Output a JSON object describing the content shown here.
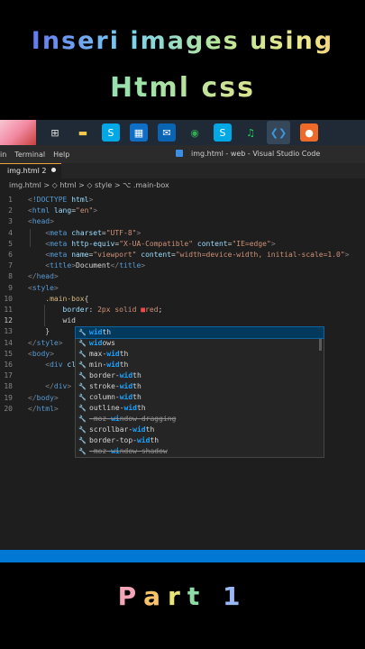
{
  "overlay": {
    "title_line1": "Inseri images using",
    "title_line2": "Html css",
    "part_letters": [
      "P",
      "a",
      "r",
      "t",
      " ",
      "1"
    ],
    "part_colors": [
      "#f4a6b8",
      "#f6c26a",
      "#e8e47a",
      "#8fd9a8",
      "#000000",
      "#9ab8f4"
    ]
  },
  "taskbar": {
    "icons": [
      {
        "name": "task-view-icon",
        "glyph": "⊞",
        "color": "#e0e0e0",
        "bg": "transparent"
      },
      {
        "name": "file-explorer-icon",
        "glyph": "▬",
        "color": "#f2c94c",
        "bg": "transparent"
      },
      {
        "name": "skype-icon",
        "glyph": "S",
        "color": "#ffffff",
        "bg": "#00a9e5"
      },
      {
        "name": "store-icon",
        "glyph": "▦",
        "color": "#ffffff",
        "bg": "#0f6fc6"
      },
      {
        "name": "mail-icon",
        "glyph": "✉",
        "color": "#ffffff",
        "bg": "#0a64b4"
      },
      {
        "name": "chrome-icon",
        "glyph": "◉",
        "color": "#34a853",
        "bg": "transparent"
      },
      {
        "name": "skype-alt-icon",
        "glyph": "S",
        "color": "#ffffff",
        "bg": "#00a9e5"
      },
      {
        "name": "spotify-icon",
        "glyph": "♫",
        "color": "#1ed760",
        "bg": "transparent"
      },
      {
        "name": "vscode-icon",
        "glyph": "❮❯",
        "color": "#3a96dd",
        "bg": "#37475a"
      },
      {
        "name": "recorder-icon",
        "glyph": "●",
        "color": "#ffffff",
        "bg": "#ee6a2b"
      }
    ]
  },
  "menubar": {
    "items": [
      "in",
      "Terminal",
      "Help"
    ],
    "window_title": "img.html - web - Visual Studio Code"
  },
  "tab": {
    "label": "img.html 2"
  },
  "breadcrumb": {
    "file": "img.html",
    "path": [
      ">",
      "◇ html",
      ">",
      "◇ style",
      ">",
      "⌥ .main-box"
    ]
  },
  "editor": {
    "lines": [
      {
        "n": "1",
        "html": "<span class='p'>&lt;</span><span class='t'>!DOCTYPE</span> <span class='a'>html</span><span class='p'>&gt;</span>"
      },
      {
        "n": "2",
        "html": "<span class='p'>&lt;</span><span class='t'>html</span> <span class='a'>lang</span>=<span class='s'>\"en\"</span><span class='p'>&gt;</span>"
      },
      {
        "n": "3",
        "html": "<span class='p'>&lt;</span><span class='t'>head</span><span class='p'>&gt;</span>"
      },
      {
        "n": "4",
        "html": "    <span class='p'>&lt;</span><span class='t'>meta</span> <span class='a'>charset</span>=<span class='s'>\"UTF-8\"</span><span class='p'>&gt;</span>"
      },
      {
        "n": "5",
        "html": "    <span class='p'>&lt;</span><span class='t'>meta</span> <span class='a'>http-equiv</span>=<span class='s'>\"X-UA-Compatible\"</span> <span class='a'>content</span>=<span class='s'>\"IE=edge\"</span><span class='p'>&gt;</span>"
      },
      {
        "n": "6",
        "html": "    <span class='p'>&lt;</span><span class='t'>meta</span> <span class='a'>name</span>=<span class='s'>\"viewport\"</span> <span class='a'>content</span>=<span class='s'>\"width=device-width, initial-scale=1.0\"</span><span class='p'>&gt;</span>"
      },
      {
        "n": "7",
        "html": "    <span class='p'>&lt;</span><span class='t'>title</span><span class='p'>&gt;</span>Document<span class='p'>&lt;/</span><span class='t'>title</span><span class='p'>&gt;</span>"
      },
      {
        "n": "8",
        "html": "<span class='p'>&lt;/</span><span class='t'>head</span><span class='p'>&gt;</span>"
      },
      {
        "n": "9",
        "html": "<span class='p'>&lt;</span><span class='t'>style</span><span class='p'>&gt;</span>"
      },
      {
        "n": "10",
        "html": "    <span class='sel'>.main-box</span>{"
      },
      {
        "n": "11",
        "html": "        <span class='a'>border</span>: <span class='s'>2px solid</span> <span class='c'>■</span><span class='s'>red</span>;"
      },
      {
        "n": "12",
        "html": "        wid"
      },
      {
        "n": "13",
        "html": "    }"
      },
      {
        "n": "14",
        "html": "<span class='p'>&lt;/</span><span class='t'>style</span><span class='p'>&gt;</span>"
      },
      {
        "n": "15",
        "html": "<span class='p'>&lt;</span><span class='t'>body</span><span class='p'>&gt;</span>"
      },
      {
        "n": "16",
        "html": "    <span class='p'>&lt;</span><span class='t'>div</span> <span class='a'>cl</span>"
      },
      {
        "n": "17",
        "html": ""
      },
      {
        "n": "18",
        "html": "    <span class='p'>&lt;/</span><span class='t'>div</span><span class='p'>&gt;</span>"
      },
      {
        "n": "19",
        "html": "<span class='p'>&lt;/</span><span class='t'>body</span><span class='p'>&gt;</span>"
      },
      {
        "n": "20",
        "html": "<span class='p'>&lt;/</span><span class='t'>html</span><span class='p'>&gt;</span>"
      }
    ],
    "current_line": "12"
  },
  "suggestions": [
    {
      "pre": "",
      "match": "wid",
      "post": "th",
      "deprecated": false
    },
    {
      "pre": "",
      "match": "wid",
      "post": "ows",
      "deprecated": false
    },
    {
      "pre": "max-",
      "match": "wid",
      "post": "th",
      "deprecated": false
    },
    {
      "pre": "min-",
      "match": "wid",
      "post": "th",
      "deprecated": false
    },
    {
      "pre": "border-",
      "match": "wid",
      "post": "th",
      "deprecated": false
    },
    {
      "pre": "stroke-",
      "match": "wid",
      "post": "th",
      "deprecated": false
    },
    {
      "pre": "column-",
      "match": "wid",
      "post": "th",
      "deprecated": false
    },
    {
      "pre": "outline-",
      "match": "wid",
      "post": "th",
      "deprecated": false
    },
    {
      "pre": "-moz-",
      "match": "wi",
      "post": "ndow-dragging",
      "deprecated": true
    },
    {
      "pre": "scrollbar-",
      "match": "wid",
      "post": "th",
      "deprecated": false
    },
    {
      "pre": "border-top-",
      "match": "wid",
      "post": "th",
      "deprecated": false
    },
    {
      "pre": "-moz-",
      "match": "wi",
      "post": "ndow-shadow",
      "deprecated": true
    }
  ]
}
